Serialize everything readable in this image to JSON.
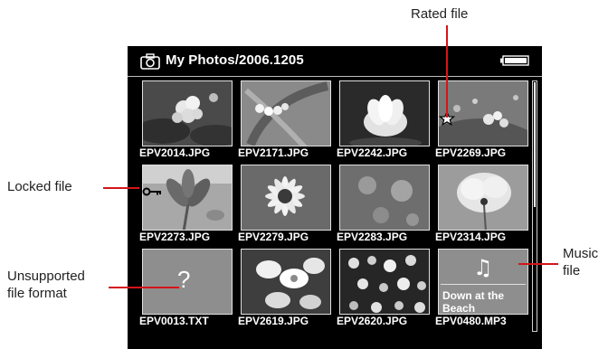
{
  "callouts": {
    "rated": "Rated file",
    "locked": "Locked file",
    "unsupported_line1": "Unsupported",
    "unsupported_line2": "file format",
    "music_line1": "Music",
    "music_line2": "file"
  },
  "screen": {
    "title": "My Photos/2006.1205",
    "files": [
      {
        "name": "EPV2014.JPG",
        "kind": "photo",
        "subject": "white-flower-cluster"
      },
      {
        "name": "EPV2171.JPG",
        "kind": "photo",
        "subject": "lily-of-the-valley"
      },
      {
        "name": "EPV2242.JPG",
        "kind": "photo",
        "subject": "white-lotus"
      },
      {
        "name": "EPV2269.JPG",
        "kind": "photo",
        "subject": "small-white-flowers",
        "rated": true
      },
      {
        "name": "EPV2273.JPG",
        "kind": "photo",
        "subject": "lily",
        "locked": true
      },
      {
        "name": "EPV2279.JPG",
        "kind": "photo",
        "subject": "daisy"
      },
      {
        "name": "EPV2283.JPG",
        "kind": "photo",
        "subject": "blurred-flowers"
      },
      {
        "name": "EPV2314.JPG",
        "kind": "photo",
        "subject": "white-dandelion"
      },
      {
        "name": "EPV0013.TXT",
        "kind": "unsupported",
        "mark": "?"
      },
      {
        "name": "EPV2619.JPG",
        "kind": "photo",
        "subject": "white-daffodils"
      },
      {
        "name": "EPV2620.JPG",
        "kind": "photo",
        "subject": "flower-bed"
      },
      {
        "name": "EPV0480.MP3",
        "kind": "music",
        "track_title": "Down at the Beach"
      }
    ]
  },
  "colors": {
    "leader_line": "#d4151a",
    "screen_background": "#000000",
    "text": "#ffffff"
  },
  "icons": {
    "camera": "camera-icon",
    "battery": "battery-icon",
    "rating": "star-icon",
    "lock": "key-icon",
    "music": "music-note-icon"
  }
}
